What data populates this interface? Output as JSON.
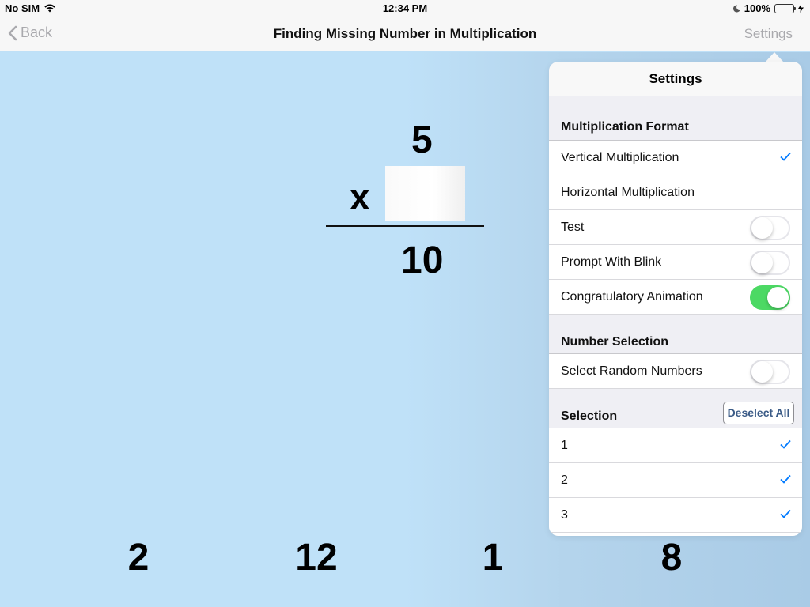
{
  "status_bar": {
    "carrier": "No SIM",
    "time": "12:34 PM",
    "battery": "100%"
  },
  "nav": {
    "back_label": "Back",
    "title": "Finding Missing Number in Multiplication",
    "settings_label": "Settings"
  },
  "problem": {
    "top_number": "5",
    "operator": "x",
    "result": "10"
  },
  "choices": [
    "2",
    "12",
    "1",
    "8"
  ],
  "settings": {
    "title": "Settings",
    "format_section": "Multiplication Format",
    "vertical_label": "Vertical Multiplication",
    "horizontal_label": "Horizontal Multiplication",
    "test_label": "Test",
    "test_on": false,
    "blink_label": "Prompt With Blink",
    "blink_on": false,
    "animation_label": "Congratulatory Animation",
    "animation_on": true,
    "number_section": "Number Selection",
    "random_label": "Select Random Numbers",
    "random_on": false,
    "selection_section": "Selection",
    "deselect_label": "Deselect All",
    "numbers": [
      "1",
      "2",
      "3"
    ]
  },
  "colors": {
    "accent": "#007aff",
    "toggle_on": "#4cd964",
    "background": "#bfe0f7"
  }
}
